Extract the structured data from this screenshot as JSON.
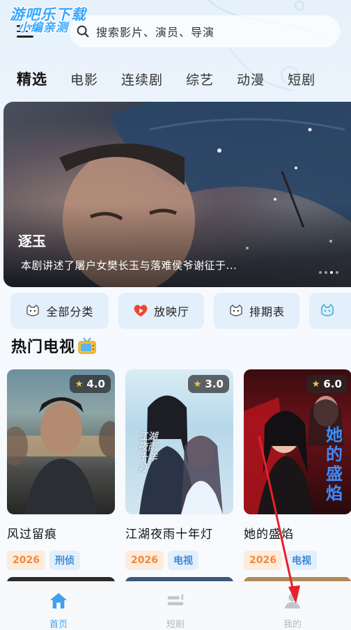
{
  "watermark": {
    "line1": "游吧乐下载",
    "line2": "小编亲测"
  },
  "search": {
    "placeholder": "搜索影片、演员、导演"
  },
  "tabs": [
    {
      "label": "精选",
      "active": true
    },
    {
      "label": "电影"
    },
    {
      "label": "连续剧"
    },
    {
      "label": "综艺"
    },
    {
      "label": "动漫"
    },
    {
      "label": "短剧"
    }
  ],
  "banner": {
    "title": "逐玉",
    "description": "本剧讲述了屠户女樊长玉与落难侯爷谢征于..."
  },
  "quick_links": [
    {
      "label": "全部分类",
      "icon": "cat-face-icon"
    },
    {
      "label": "放映厅",
      "icon": "play-heart-icon"
    },
    {
      "label": "排期表",
      "icon": "cat-face-icon"
    },
    {
      "label": "",
      "icon": "cat-face-icon"
    }
  ],
  "section": {
    "title": "热门电视",
    "icon": "tv-icon"
  },
  "cards": [
    {
      "title": "风过留痕",
      "rating": "4.0",
      "year": "2026",
      "genre": "刑侦"
    },
    {
      "title": "江湖夜雨十年灯",
      "rating": "3.0",
      "year": "2026",
      "genre": "电视",
      "poster_text": "江湖夜雨十年灯"
    },
    {
      "title": "她的盛焰",
      "rating": "6.0",
      "year": "2026",
      "genre": "电视",
      "poster_text": "她的盛焰"
    }
  ],
  "nav": [
    {
      "label": "首页",
      "icon": "home-icon",
      "active": true
    },
    {
      "label": "短剧",
      "icon": "short-drama-icon"
    },
    {
      "label": "我的",
      "icon": "user-icon"
    }
  ],
  "colors": {
    "accent": "#3fa0ee",
    "year_tag": "#f08a3c",
    "genre_tag": "#3c8ad9",
    "annotation": "#e8202a"
  }
}
